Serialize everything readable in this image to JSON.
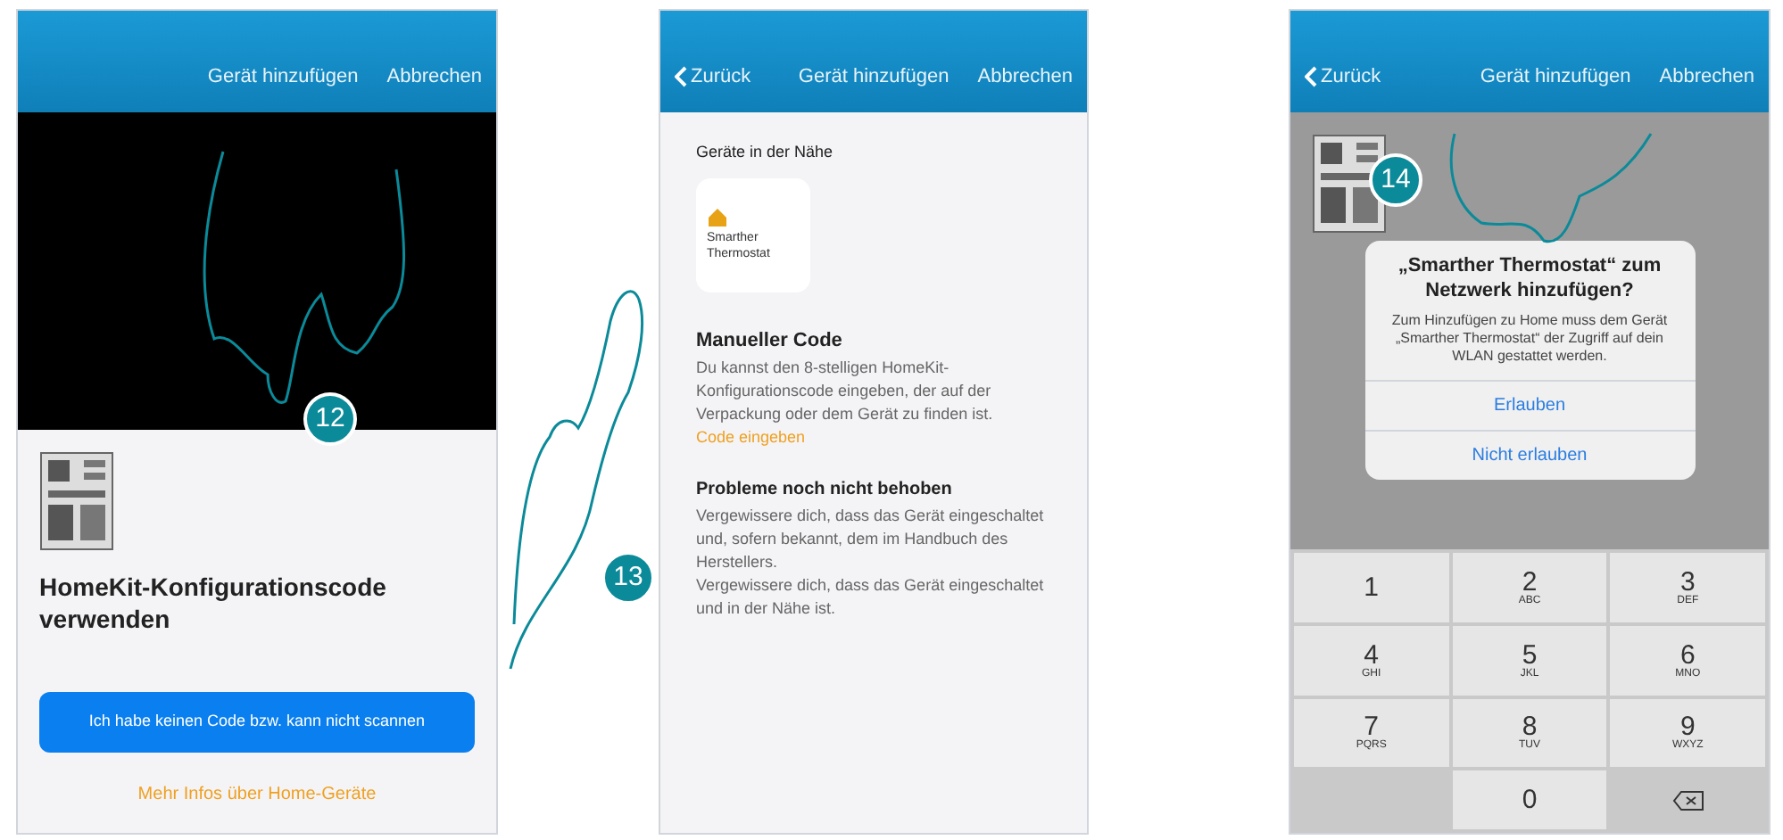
{
  "scan_screen": {
    "step": "12",
    "header": {
      "title": "Gerät hinzufügen",
      "cancel": "Abbrechen"
    },
    "heading": "HomeKit-Konfigurationscode verwenden",
    "button": "Ich habe keinen Code bzw. kann nicht scannen",
    "link": "Mehr Infos über Home-Geräte"
  },
  "nearby_screen": {
    "step": "13",
    "header": {
      "back": "Zurück",
      "title": "Gerät hinzufügen",
      "cancel": "Abbrechen"
    },
    "section": "Geräte in der Nähe",
    "device": "Smarther Thermostat",
    "code_heading": "Manueller Code",
    "code_text": "Du kannst den 8-stelligen HomeKit-Konfigurationscode eingeben, der auf der Verpackung oder dem Gerät zu finden ist.",
    "code_link": "Code eingeben",
    "problem_heading": "Probleme noch nicht behoben",
    "problem_text": [
      "Vergewissere dich, dass das Gerät eingeschaltet und, sofern bekannt, dem im Handbuch des Herstellers.",
      "Vergewissere dich, dass das Gerät eingeschaltet und in der Nähe ist."
    ]
  },
  "permission_screen": {
    "step": "14",
    "header": {
      "back": "Zurück",
      "title": "Gerät hinzufügen",
      "cancel": "Abbrechen"
    },
    "dialog": {
      "title": "„Smarther Thermostat“ zum Netzwerk hinzufügen?",
      "text": "Zum Hinzufügen zu Home muss dem Gerät „Smarther Thermostat“ der Zugriff auf dein WLAN gestattet werden.",
      "allow": "Erlauben",
      "deny": "Nicht erlauben"
    },
    "keypad": [
      {
        "digit": "1"
      },
      {
        "digit": "2",
        "letters": "ABC"
      },
      {
        "digit": "3",
        "letters": "DEF"
      },
      {
        "digit": "4",
        "letters": "GHI"
      },
      {
        "digit": "5",
        "letters": "JKL"
      },
      {
        "digit": "6",
        "letters": "MNO"
      },
      {
        "digit": "7",
        "letters": "PQRS"
      },
      {
        "digit": "8",
        "letters": "TUV"
      },
      {
        "digit": "9",
        "letters": "WXYZ"
      },
      {
        "digit": "0"
      }
    ]
  }
}
